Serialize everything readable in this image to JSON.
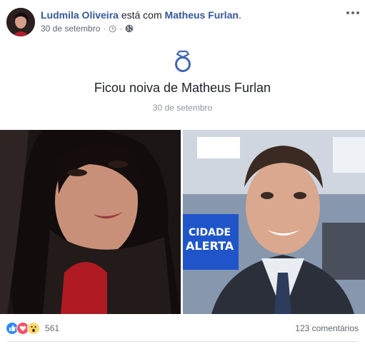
{
  "post": {
    "author": "Ludmila Oliveira",
    "with_text": " está com ",
    "tagged": "Matheus Furlan",
    "period": ".",
    "date": "30 de setembro",
    "separator": "·"
  },
  "life_event": {
    "icon": "engagement-ring-icon",
    "title": "Ficou noiva de Matheus Furlan",
    "date": "30 de setembro"
  },
  "footer": {
    "reaction_icons": [
      "like-icon",
      "love-icon",
      "wow-icon"
    ],
    "reaction_count": "561",
    "comments": "123 comentários"
  },
  "colors": {
    "link": "#365899",
    "secondary_text": "#616770",
    "like": "#2e89ff",
    "love": "#f25268",
    "wow": "#fcd96b"
  }
}
